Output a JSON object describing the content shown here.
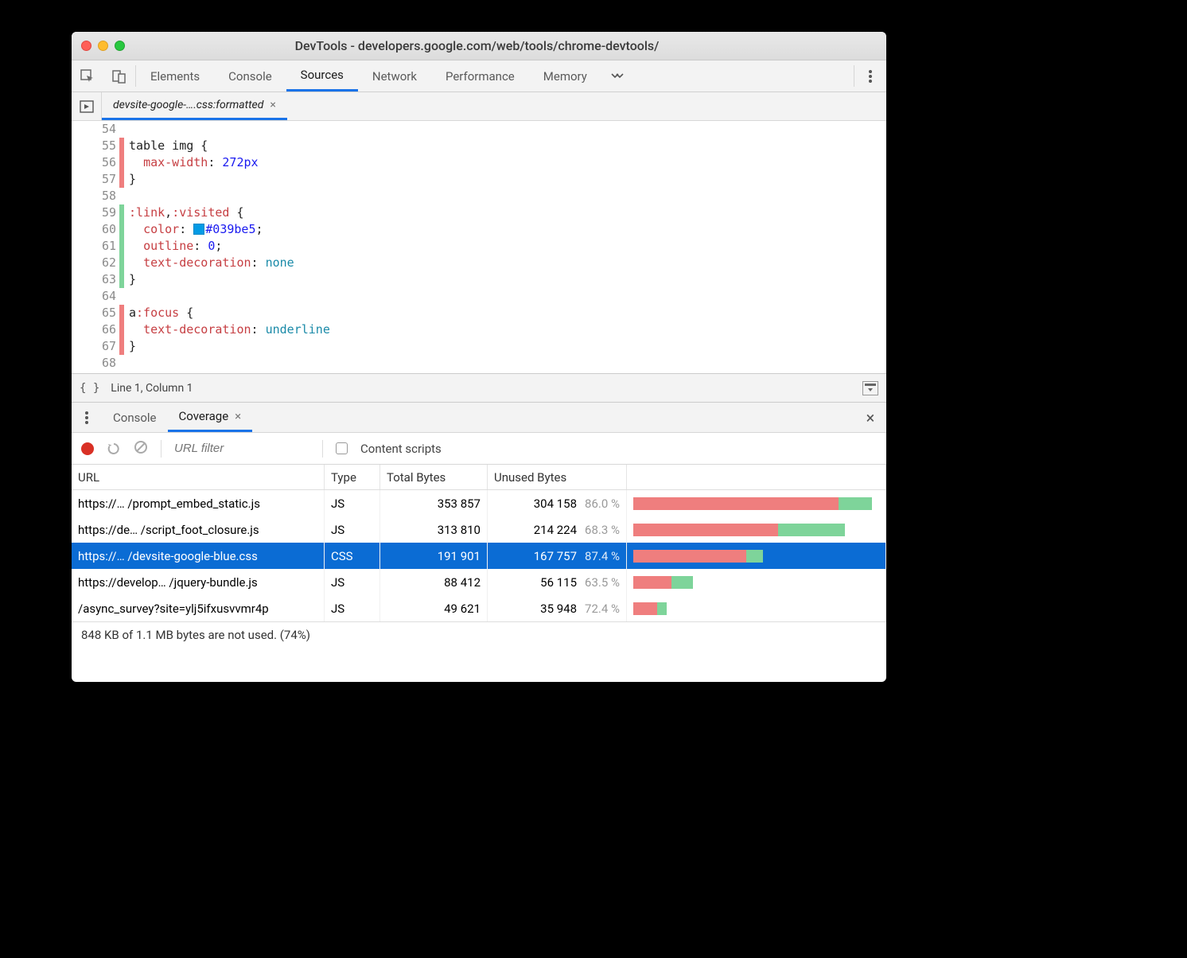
{
  "window": {
    "title": "DevTools - developers.google.com/web/tools/chrome-devtools/"
  },
  "mainTabs": {
    "items": [
      "Elements",
      "Console",
      "Sources",
      "Network",
      "Performance",
      "Memory"
    ],
    "activeIndex": 2
  },
  "fileTab": {
    "label": "devsite-google-….css:formatted"
  },
  "code": {
    "lines": [
      {
        "n": 54,
        "cov": "",
        "html": ""
      },
      {
        "n": 55,
        "cov": "r",
        "html": "table img {"
      },
      {
        "n": 56,
        "cov": "r",
        "html": "  <span class=\"prop\">max-width</span>: <span class=\"val\">272px</span>"
      },
      {
        "n": 57,
        "cov": "r",
        "html": "}"
      },
      {
        "n": 58,
        "cov": "",
        "html": ""
      },
      {
        "n": 59,
        "cov": "g",
        "html": "<span class=\"sel\">:link</span>,<span class=\"sel\">:visited</span> {"
      },
      {
        "n": 60,
        "cov": "g",
        "html": "  <span class=\"prop\">color</span>: <span class=\"swatch\"></span><span class=\"val\">#039be5</span>;"
      },
      {
        "n": 61,
        "cov": "g",
        "html": "  <span class=\"prop\">outline</span>: <span class=\"val\">0</span>;"
      },
      {
        "n": 62,
        "cov": "g",
        "html": "  <span class=\"prop\">text-decoration</span>: <span class=\"kw\">none</span>"
      },
      {
        "n": 63,
        "cov": "g",
        "html": "}"
      },
      {
        "n": 64,
        "cov": "",
        "html": ""
      },
      {
        "n": 65,
        "cov": "r",
        "html": "a<span class=\"sel\">:focus</span> {"
      },
      {
        "n": 66,
        "cov": "r",
        "html": "  <span class=\"prop\">text-decoration</span>: <span class=\"kw\">underline</span>"
      },
      {
        "n": 67,
        "cov": "r",
        "html": "}"
      },
      {
        "n": 68,
        "cov": "",
        "html": ""
      }
    ]
  },
  "status": {
    "cursor": "Line 1, Column 1"
  },
  "drawerTabs": {
    "items": [
      "Console",
      "Coverage"
    ],
    "activeIndex": 1
  },
  "coverageToolbar": {
    "urlFilterPlaceholder": "URL filter",
    "contentScriptsLabel": "Content scripts"
  },
  "coverageTable": {
    "headers": {
      "url": "URL",
      "type": "Type",
      "total": "Total Bytes",
      "unused": "Unused Bytes"
    },
    "maxTotal": 353857,
    "rows": [
      {
        "url": "https://… /prompt_embed_static.js",
        "type": "JS",
        "total": "353 857",
        "unused": "304 158",
        "pct": "86.0 %",
        "totalN": 353857,
        "unusedN": 304158,
        "selected": false
      },
      {
        "url": "https://de… /script_foot_closure.js",
        "type": "JS",
        "total": "313 810",
        "unused": "214 224",
        "pct": "68.3 %",
        "totalN": 313810,
        "unusedN": 214224,
        "selected": false
      },
      {
        "url": "https://… /devsite-google-blue.css",
        "type": "CSS",
        "total": "191 901",
        "unused": "167 757",
        "pct": "87.4 %",
        "totalN": 191901,
        "unusedN": 167757,
        "selected": true
      },
      {
        "url": "https://develop… /jquery-bundle.js",
        "type": "JS",
        "total": "88 412",
        "unused": "56 115",
        "pct": "63.5 %",
        "totalN": 88412,
        "unusedN": 56115,
        "selected": false
      },
      {
        "url": "/async_survey?site=ylj5ifxusvvmr4p",
        "type": "JS",
        "total": "49 621",
        "unused": "35 948",
        "pct": "72.4 %",
        "totalN": 49621,
        "unusedN": 35948,
        "selected": false
      }
    ],
    "footer": "848 KB of 1.1 MB bytes are not used. (74%)"
  }
}
